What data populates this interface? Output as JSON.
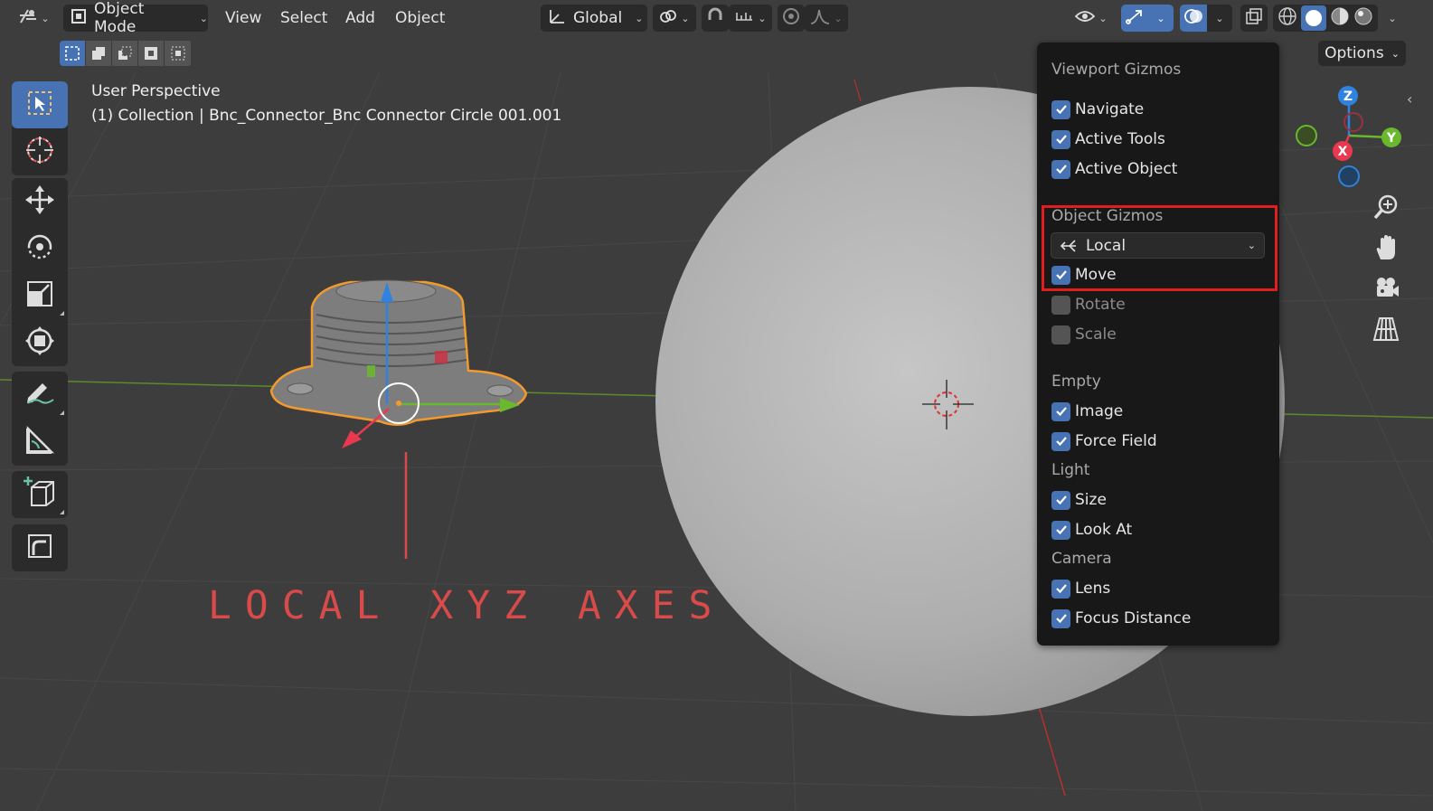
{
  "header": {
    "editor_type_icon": "editor-type-icon",
    "mode_label": "Object Mode",
    "menus": [
      "View",
      "Select",
      "Add",
      "Object"
    ],
    "transform_orientation": "Global",
    "options_label": "Options"
  },
  "viewport": {
    "perspective_label": "User Perspective",
    "collection_label": "(1) Collection | Bnc_Connector_Bnc Connector Circle 001.001"
  },
  "popover": {
    "title": "Viewport Gizmos",
    "viewport_items": [
      {
        "label": "Navigate",
        "checked": true
      },
      {
        "label": "Active Tools",
        "checked": true
      },
      {
        "label": "Active Object",
        "checked": true
      }
    ],
    "object_gizmos_title": "Object Gizmos",
    "orientation_value": "Local",
    "object_items": [
      {
        "label": "Move",
        "checked": true
      },
      {
        "label": "Rotate",
        "checked": false
      },
      {
        "label": "Scale",
        "checked": false
      }
    ],
    "empty_title": "Empty",
    "empty_items": [
      {
        "label": "Image",
        "checked": true
      },
      {
        "label": "Force Field",
        "checked": true
      }
    ],
    "light_title": "Light",
    "light_items": [
      {
        "label": "Size",
        "checked": true
      },
      {
        "label": "Look At",
        "checked": true
      }
    ],
    "camera_title": "Camera",
    "camera_items": [
      {
        "label": "Lens",
        "checked": true
      },
      {
        "label": "Focus Distance",
        "checked": true
      }
    ]
  },
  "nav_gizmo": {
    "z_label": "Z",
    "y_label": "Y",
    "x_label": "X"
  },
  "annotation_text": "LOCAL XYZ AXES",
  "colors": {
    "accent": "#4772b3",
    "highlight_box": "#e01e1e",
    "annotation": "#d94a4a",
    "x_axis": "#e8394f",
    "y_axis": "#6ab82d",
    "z_axis": "#2f82de"
  }
}
